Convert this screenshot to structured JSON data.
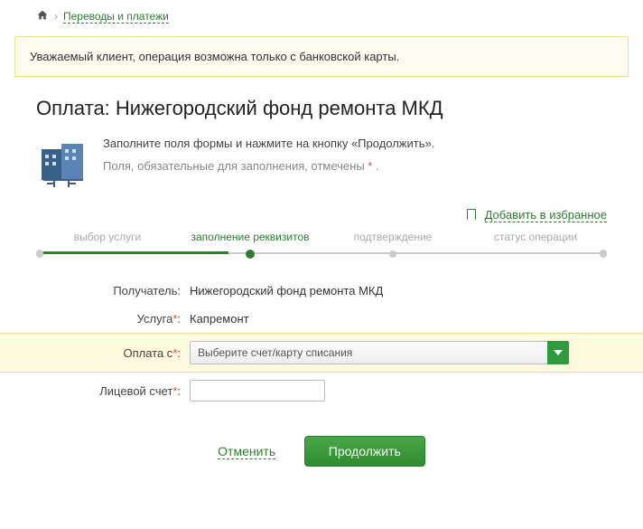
{
  "breadcrumb": {
    "payments_label": "Переводы и платежи"
  },
  "notice": "Уважаемый клиент, операция возможна только с банковской карты.",
  "page_title": "Оплата: Нижегородский фонд ремонта МКД",
  "intro": {
    "line1": "Заполните поля формы и нажмите на кнопку «Продолжить».",
    "line2_pre": "Поля, обязательные для заполнения, отмечены ",
    "line2_post": " ."
  },
  "favorite_label": "Добавить в избранное",
  "steps": {
    "s1": "выбор услуги",
    "s2": "заполнение реквизитов",
    "s3": "подтверждение",
    "s4": "статус операции"
  },
  "form": {
    "recipient_label": "Получатель:",
    "recipient_value": "Нижегородский фонд ремонта МКД",
    "service_label": "Услуга",
    "service_value": "Капремонт",
    "pay_from_label": "Оплата с",
    "pay_from_placeholder": "Выберите счет/карту списания",
    "account_label": "Лицевой счет",
    "account_value": ""
  },
  "actions": {
    "cancel": "Отменить",
    "continue": "Продолжить"
  },
  "req_mark": "*"
}
